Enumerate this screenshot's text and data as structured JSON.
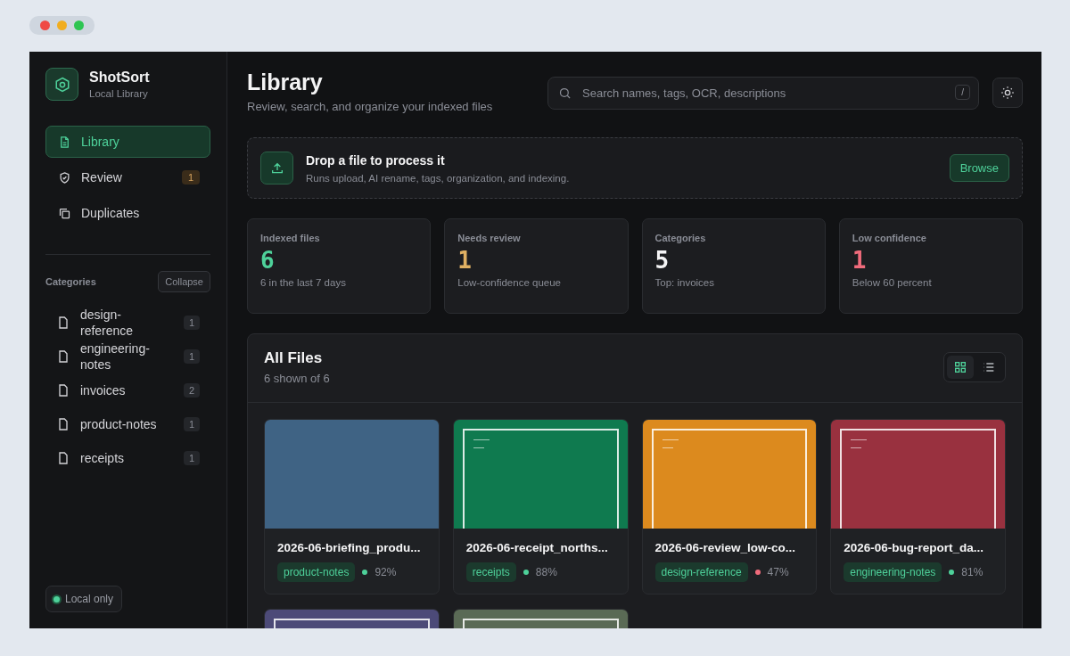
{
  "app": {
    "name": "ShotSort",
    "subtitle": "Local Library"
  },
  "nav": [
    {
      "kind": "library",
      "label": "Library",
      "selected": true
    },
    {
      "kind": "review",
      "label": "Review",
      "selected": false,
      "badge": "1"
    },
    {
      "kind": "duplicates",
      "label": "Duplicates",
      "selected": false
    }
  ],
  "categories": {
    "title": "Categories",
    "collapse_button": "Collapse",
    "items": [
      {
        "label": "design-reference",
        "count": "1"
      },
      {
        "label": "engineering-notes",
        "count": "1"
      },
      {
        "label": "invoices",
        "count": "2"
      },
      {
        "label": "product-notes",
        "count": "1"
      },
      {
        "label": "receipts",
        "count": "1"
      }
    ]
  },
  "status": {
    "label": "Local only",
    "on": true
  },
  "header": {
    "title": "Library",
    "subtitle": "Review, search, and organize your indexed files"
  },
  "search": {
    "placeholder": "Search names, tags, OCR, descriptions",
    "shortcut": "/"
  },
  "dropzone": {
    "title": "Drop a file to process it",
    "description": "Runs upload, AI rename, tags, organization, and indexing.",
    "button": "Browse"
  },
  "stats": [
    {
      "label": "Indexed files",
      "value": "6",
      "note": "6 in the last 7 days",
      "color": "#4ed19a"
    },
    {
      "label": "Needs review",
      "value": "1",
      "note": "Low-confidence queue",
      "color": "#e0b062"
    },
    {
      "label": "Categories",
      "value": "5",
      "note": "Top: invoices",
      "color": "#f4f4f5"
    },
    {
      "label": "Low confidence",
      "value": "1",
      "note": "Below 60 percent",
      "color": "#ef6b7b"
    }
  ],
  "files_panel": {
    "title": "All Files",
    "subtitle": "6 shown of 6",
    "views": [
      {
        "kind": "grid",
        "selected": true
      },
      {
        "kind": "list",
        "selected": false
      }
    ]
  },
  "files": [
    {
      "kind": "blank",
      "color": "#3f6384",
      "name": "2026-06-briefing_produ...",
      "tag": "product-notes",
      "confidence": "92%",
      "low_confidence": false
    },
    {
      "kind": "document",
      "color": "#0f7a4f",
      "name": "2026-06-receipt_norths...",
      "tag": "receipts",
      "confidence": "88%",
      "low_confidence": false
    },
    {
      "kind": "document",
      "color": "#dc8a1e",
      "name": "2026-06-review_low-co...",
      "tag": "design-reference",
      "confidence": "47%",
      "low_confidence": true
    },
    {
      "kind": "document",
      "color": "#99313f",
      "name": "2026-06-bug-report_da...",
      "tag": "engineering-notes",
      "confidence": "81%",
      "low_confidence": false
    },
    {
      "kind": "document",
      "color": "#4c4a78"
    },
    {
      "kind": "document",
      "color": "#5a6a55"
    }
  ]
}
